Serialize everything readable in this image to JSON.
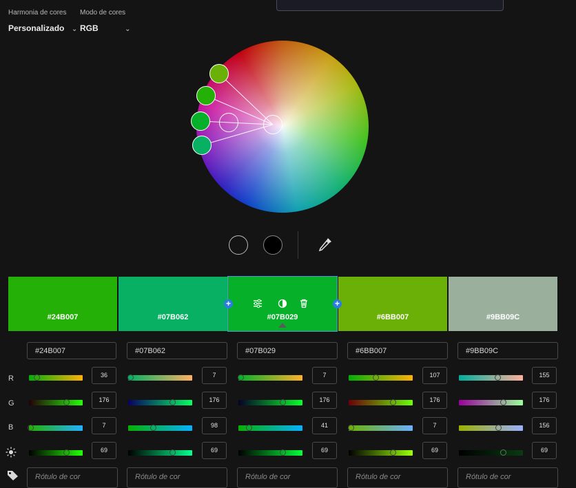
{
  "harmony": {
    "label": "Harmonia de cores",
    "value": "Personalizado"
  },
  "mode": {
    "label": "Modo de cores",
    "value": "RGB"
  },
  "swatches": [
    {
      "hex": "#24B007",
      "color": "#24B007"
    },
    {
      "hex": "#07B062",
      "color": "#07B062"
    },
    {
      "hex": "#07B029",
      "color": "#07B029"
    },
    {
      "hex": "#6BB007",
      "color": "#6BB007"
    },
    {
      "hex": "#9BB09C",
      "color": "#9BB09C"
    }
  ],
  "channels": [
    {
      "key": "R",
      "label": "R"
    },
    {
      "key": "G",
      "label": "G"
    },
    {
      "key": "B",
      "label": "B"
    },
    {
      "key": "brightness",
      "icon": "sun-icon"
    }
  ],
  "values": [
    {
      "hex": "#24B007",
      "r": "36",
      "g": "176",
      "b": "7",
      "brightness": "69"
    },
    {
      "hex": "#07B062",
      "r": "7",
      "g": "176",
      "b": "98",
      "brightness": "69"
    },
    {
      "hex": "#07B029",
      "r": "7",
      "g": "176",
      "b": "41",
      "brightness": "69"
    },
    {
      "hex": "#6BB007",
      "r": "107",
      "g": "176",
      "b": "7",
      "brightness": "69"
    },
    {
      "hex": "#9BB09C",
      "r": "155",
      "g": "176",
      "b": "156",
      "brightness": "69"
    }
  ],
  "tag_placeholder": "Rótulo de cor",
  "icons": {
    "tag": "tag-icon",
    "eyedropper": "eyedropper-icon",
    "adjust": "sliders-icon",
    "contrast": "contrast-icon",
    "delete": "trash-icon",
    "add": "plus-icon",
    "chevron": "chevron-down-icon"
  },
  "accent": "#2b7de0"
}
